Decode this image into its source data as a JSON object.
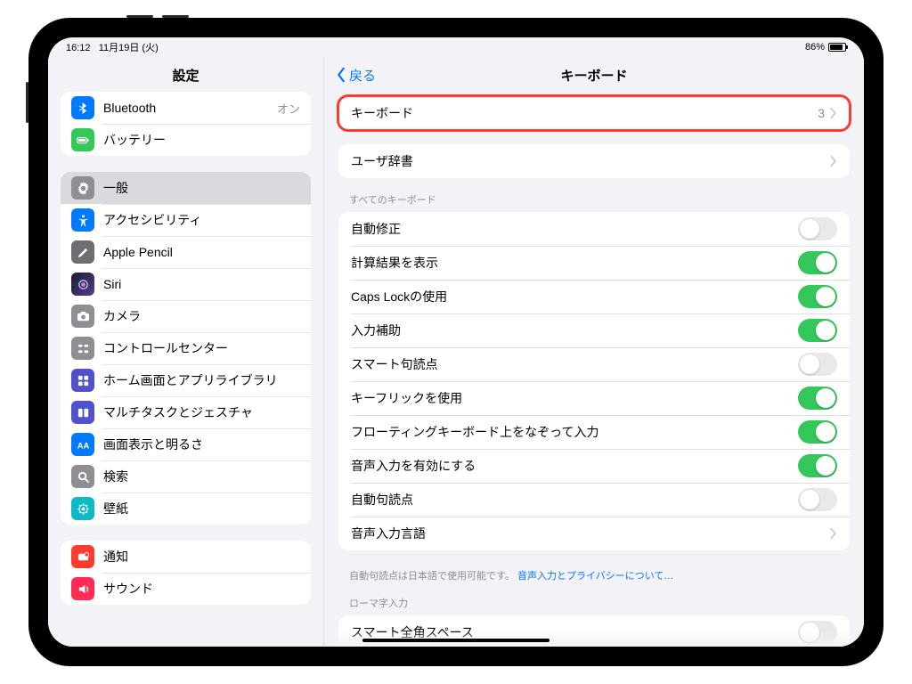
{
  "status": {
    "time": "16:12",
    "date": "11月19日 (火)",
    "battery_pct": "86%"
  },
  "sidebar": {
    "title": "設定",
    "group1": [
      {
        "icon": "bluetooth",
        "color": "#007aff",
        "label": "Bluetooth",
        "detail": "オン"
      },
      {
        "icon": "battery",
        "color": "#34c759",
        "label": "バッテリー"
      }
    ],
    "group2": [
      {
        "icon": "gear",
        "color": "#8e8e93",
        "label": "一般",
        "selected": true
      },
      {
        "icon": "access",
        "color": "#007aff",
        "label": "アクセシビリティ"
      },
      {
        "icon": "pencil",
        "color": "#6e6e73",
        "label": "Apple Pencil"
      },
      {
        "icon": "siri",
        "color": "grad",
        "label": "Siri"
      },
      {
        "icon": "camera",
        "color": "#8e8e93",
        "label": "カメラ"
      },
      {
        "icon": "control",
        "color": "#8e8e93",
        "label": "コントロールセンター"
      },
      {
        "icon": "home",
        "color": "#5151ce",
        "label": "ホーム画面とアプリライブラリ"
      },
      {
        "icon": "multitask",
        "color": "#5151ce",
        "label": "マルチタスクとジェスチャ"
      },
      {
        "icon": "display",
        "color": "#007aff",
        "label": "画面表示と明るさ"
      },
      {
        "icon": "search",
        "color": "#8e8e93",
        "label": "検索"
      },
      {
        "icon": "wallpaper",
        "color": "#10b9c6",
        "label": "壁紙"
      }
    ],
    "group3": [
      {
        "icon": "notif",
        "color": "#ff3b30",
        "label": "通知"
      },
      {
        "icon": "sound",
        "color": "#ff2d55",
        "label": "サウンド"
      }
    ]
  },
  "detail": {
    "back": "戻る",
    "title": "キーボード",
    "keyboards_row": {
      "label": "キーボード",
      "count": "3"
    },
    "userdict_row": {
      "label": "ユーザ辞書"
    },
    "allkb_header": "すべてのキーボード",
    "toggles": [
      {
        "label": "自動修正",
        "on": false
      },
      {
        "label": "計算結果を表示",
        "on": true
      },
      {
        "label": "Caps Lockの使用",
        "on": true
      },
      {
        "label": "入力補助",
        "on": true
      },
      {
        "label": "スマート句読点",
        "on": false
      },
      {
        "label": "キーフリックを使用",
        "on": true
      },
      {
        "label": "フローティングキーボード上をなぞって入力",
        "on": true
      },
      {
        "label": "音声入力を有効にする",
        "on": true
      },
      {
        "label": "自動句読点",
        "on": false
      }
    ],
    "lang_row": {
      "label": "音声入力言語"
    },
    "footer_text": "自動句読点は日本語で使用可能です。",
    "footer_link": "音声入力とプライバシーについて…",
    "romaji_header": "ローマ字入力",
    "romaji_row": {
      "label": "スマート全角スペース",
      "on": false
    }
  }
}
